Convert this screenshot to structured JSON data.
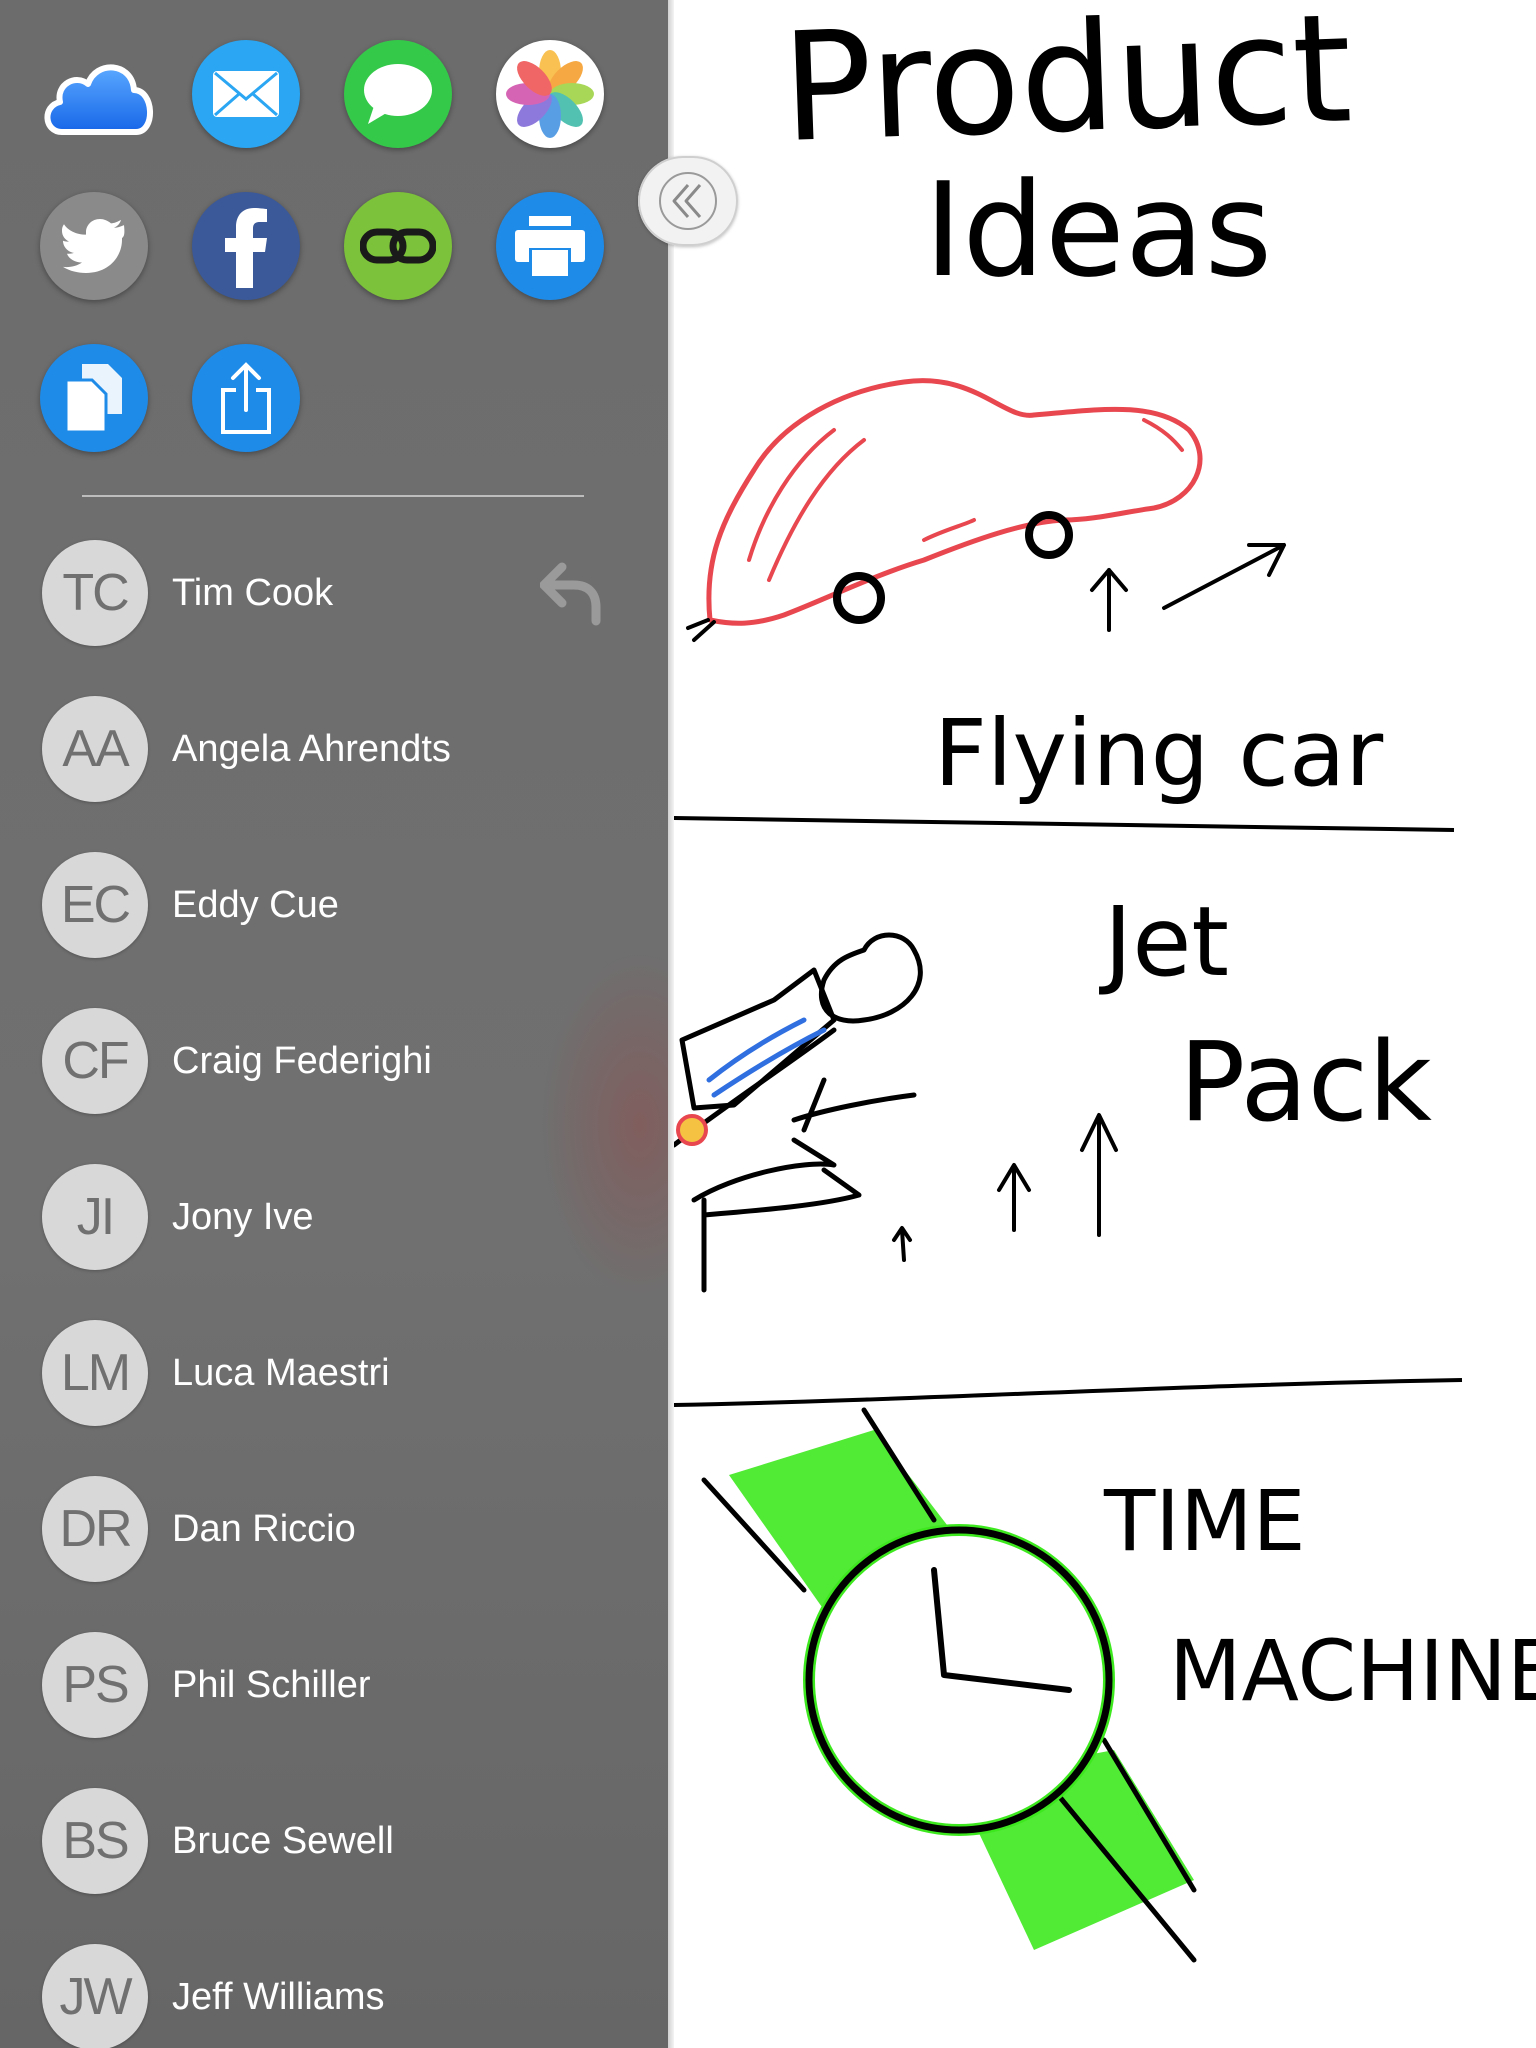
{
  "share_targets": [
    {
      "name": "icloud",
      "color": "#2f7df4"
    },
    {
      "name": "mail",
      "color": "#2aa6f2"
    },
    {
      "name": "messages",
      "color": "#35c94a"
    },
    {
      "name": "photos",
      "color": "#ffffff"
    },
    {
      "name": "twitter",
      "color": "#8a8a8a"
    },
    {
      "name": "facebook",
      "color": "#3b5998"
    },
    {
      "name": "link",
      "color": "#7cc23a"
    },
    {
      "name": "print",
      "color": "#1f8be8"
    },
    {
      "name": "copy",
      "color": "#1f8be8"
    },
    {
      "name": "share",
      "color": "#1f8be8"
    }
  ],
  "contacts": [
    {
      "initials": "TC",
      "name": "Tim Cook"
    },
    {
      "initials": "AA",
      "name": "Angela Ahrendts"
    },
    {
      "initials": "EC",
      "name": "Eddy Cue"
    },
    {
      "initials": "CF",
      "name": "Craig Federighi"
    },
    {
      "initials": "JI",
      "name": "Jony Ive"
    },
    {
      "initials": "LM",
      "name": "Luca Maestri"
    },
    {
      "initials": "DR",
      "name": "Dan Riccio"
    },
    {
      "initials": "PS",
      "name": "Phil Schiller"
    },
    {
      "initials": "BS",
      "name": "Bruce Sewell"
    },
    {
      "initials": "JW",
      "name": "Jeff Williams"
    }
  ],
  "sketch": {
    "title_line1": "Product",
    "title_line2": "Ideas",
    "idea1": "Flying car",
    "idea2_line1": "Jet",
    "idea2_line2": "Pack",
    "idea3_line1": "TIME",
    "idea3_line2": "MACHINE"
  },
  "colors": {
    "sidebar": "#707070",
    "avatar": "#d8d8d8",
    "ink": "#000000",
    "car": "#e8474f",
    "watch_band": "#3ee81f",
    "jetpack": "#2f6fe0"
  }
}
